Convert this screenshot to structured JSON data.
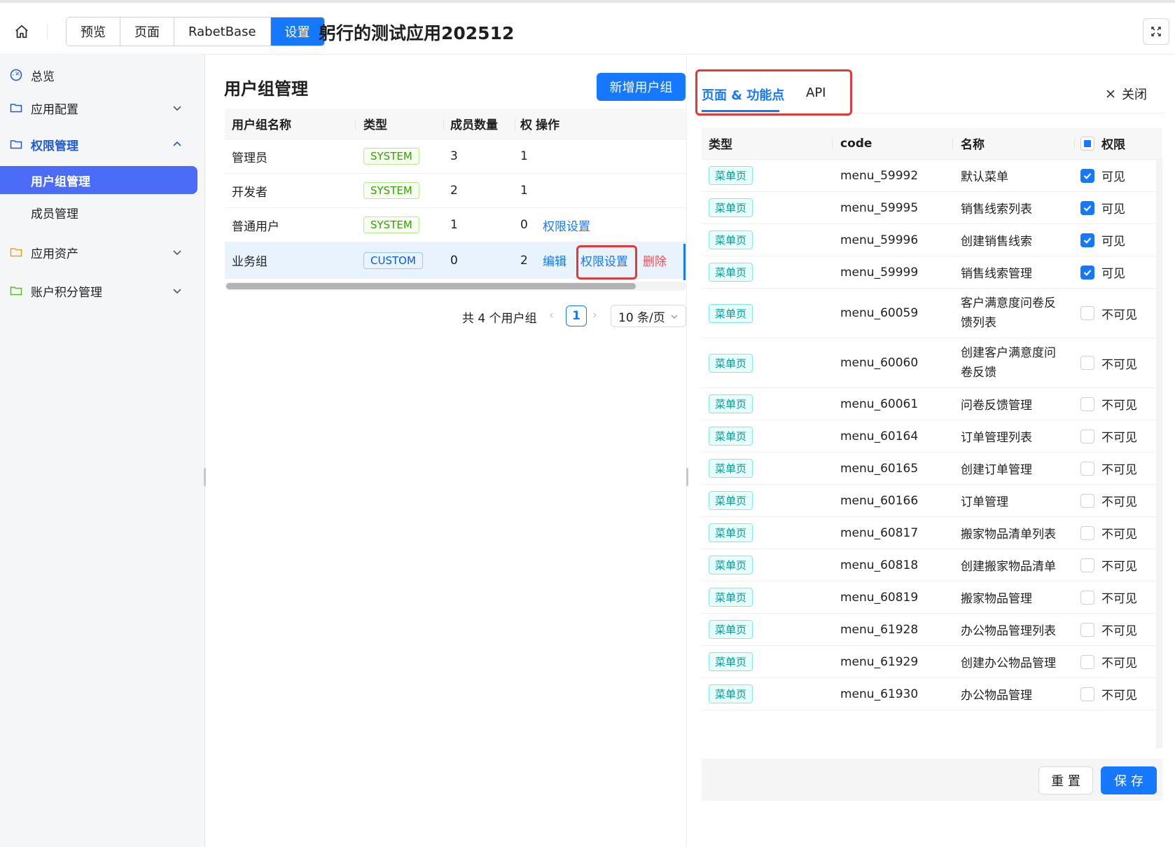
{
  "header": {
    "nav_tabs": [
      {
        "label": "预览",
        "active": false
      },
      {
        "label": "页面",
        "active": false
      },
      {
        "label": "RabetBase",
        "active": false
      },
      {
        "label": "设置",
        "active": true
      }
    ],
    "app_title": "躬行的测试应用202512",
    "accent_color": "#1677ff"
  },
  "sidebar": {
    "items": [
      {
        "label": "总览",
        "icon": "dashboard-icon"
      },
      {
        "label": "应用配置",
        "icon": "folder-icon",
        "expanded": false
      },
      {
        "label": "权限管理",
        "icon": "folder-icon",
        "expanded": true
      },
      {
        "label": "用户组管理",
        "selected": true
      },
      {
        "label": "成员管理"
      },
      {
        "label": "应用资产",
        "icon": "folder-icon",
        "expanded": false
      },
      {
        "label": "账户积分管理",
        "icon": "folder-icon",
        "expanded": false
      }
    ]
  },
  "groups": {
    "title": "用户组管理",
    "add_button": "新增用户组",
    "columns": [
      "用户组名称",
      "类型",
      "成员数量",
      "权",
      "操作"
    ],
    "rows": [
      {
        "name": "管理员",
        "type": "SYSTEM",
        "members": "3",
        "perm": "1",
        "actions": []
      },
      {
        "name": "开发者",
        "type": "SYSTEM",
        "members": "2",
        "perm": "1",
        "actions": []
      },
      {
        "name": "普通用户",
        "type": "SYSTEM",
        "members": "1",
        "perm": "0",
        "actions": [
          "权限设置"
        ]
      },
      {
        "name": "业务组",
        "type": "CUSTOM",
        "members": "0",
        "perm": "2",
        "actions": [
          "编辑",
          "权限设置",
          "删除"
        ]
      }
    ],
    "pagination": {
      "total_text": "共 4 个用户组",
      "current_page": "1",
      "page_size": "10 条/页"
    }
  },
  "permissions": {
    "tabs": [
      "页面 & 功能点",
      "API"
    ],
    "active_tab": "页面 & 功能点",
    "close_label": "关闭",
    "columns": [
      "类型",
      "code",
      "名称",
      "权限"
    ],
    "rows": [
      {
        "type": "菜单页",
        "code": "menu_59992",
        "name": "默认菜单",
        "visible": true,
        "perm": "可见"
      },
      {
        "type": "菜单页",
        "code": "menu_59995",
        "name": "销售线索列表",
        "visible": true,
        "perm": "可见"
      },
      {
        "type": "菜单页",
        "code": "menu_59996",
        "name": "创建销售线索",
        "visible": true,
        "perm": "可见"
      },
      {
        "type": "菜单页",
        "code": "menu_59999",
        "name": "销售线索管理",
        "visible": true,
        "perm": "可见"
      },
      {
        "type": "菜单页",
        "code": "menu_60059",
        "name": "客户满意度问卷反馈列表",
        "visible": false,
        "perm": "不可见"
      },
      {
        "type": "菜单页",
        "code": "menu_60060",
        "name": "创建客户满意度问卷反馈",
        "visible": false,
        "perm": "不可见"
      },
      {
        "type": "菜单页",
        "code": "menu_60061",
        "name": "问卷反馈管理",
        "visible": false,
        "perm": "不可见"
      },
      {
        "type": "菜单页",
        "code": "menu_60164",
        "name": "订单管理列表",
        "visible": false,
        "perm": "不可见"
      },
      {
        "type": "菜单页",
        "code": "menu_60165",
        "name": "创建订单管理",
        "visible": false,
        "perm": "不可见"
      },
      {
        "type": "菜单页",
        "code": "menu_60166",
        "name": "订单管理",
        "visible": false,
        "perm": "不可见"
      },
      {
        "type": "菜单页",
        "code": "menu_60817",
        "name": "搬家物品清单列表",
        "visible": false,
        "perm": "不可见"
      },
      {
        "type": "菜单页",
        "code": "menu_60818",
        "name": "创建搬家物品清单",
        "visible": false,
        "perm": "不可见"
      },
      {
        "type": "菜单页",
        "code": "menu_60819",
        "name": "搬家物品管理",
        "visible": false,
        "perm": "不可见"
      },
      {
        "type": "菜单页",
        "code": "menu_61928",
        "name": "办公物品管理列表",
        "visible": false,
        "perm": "不可见"
      },
      {
        "type": "菜单页",
        "code": "menu_61929",
        "name": "创建办公物品管理",
        "visible": false,
        "perm": "不可见"
      },
      {
        "type": "菜单页",
        "code": "menu_61930",
        "name": "办公物品管理",
        "visible": false,
        "perm": "不可见"
      }
    ],
    "reset_label": "重 置",
    "save_label": "保 存"
  }
}
